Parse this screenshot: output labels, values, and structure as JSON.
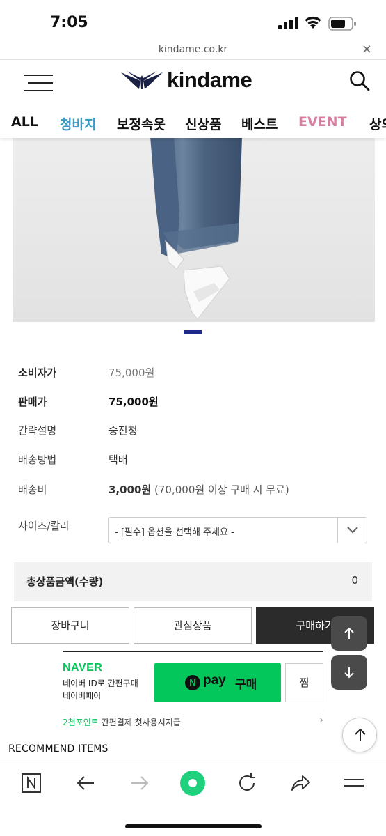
{
  "status": {
    "time": "7:05"
  },
  "urlbar": {
    "url": "kindame.co.kr",
    "close": "×"
  },
  "header": {
    "logo_text": "kindame"
  },
  "nav": {
    "items": [
      {
        "label": "ALL",
        "color": "#111111"
      },
      {
        "label": "청바지",
        "color": "#3a9bc8"
      },
      {
        "label": "보정속옷",
        "color": "#111111"
      },
      {
        "label": "신상품",
        "color": "#111111"
      },
      {
        "label": "베스트",
        "color": "#111111"
      },
      {
        "label": "EVENT",
        "color": "#d77da0"
      },
      {
        "label": "상의",
        "color": "#111111"
      }
    ]
  },
  "product": {
    "consumer_price_label": "소비자가",
    "consumer_price": "75,000원",
    "sale_price_label": "판매가",
    "sale_price": "75,000원",
    "summary_label": "간략설명",
    "summary": "중진청",
    "shipping_method_label": "배송방법",
    "shipping_method": "택배",
    "shipping_fee_label": "배송비",
    "shipping_fee": "3,000원",
    "shipping_fee_note": "(70,000원 이상 구매 시 무료)",
    "option_label": "사이즈/칼라",
    "option_placeholder": "- [필수] 옵션을 선택해 주세요 -"
  },
  "total": {
    "label": "총상품금액(수량)",
    "value": "0"
  },
  "buttons": {
    "cart": "장바구니",
    "wishlist": "관심상품",
    "buy": "구매하기"
  },
  "naver": {
    "brand": "NAVER",
    "desc_line1": "네이버 ID로 간편구매",
    "desc_line2": "네이버페이",
    "n_badge": "N",
    "pay": "pay",
    "buy": "구매",
    "jjim": "찜",
    "point_green": "2천포인트",
    "point_rest": " 간편결제 첫사용시지급",
    "chevron": "›"
  },
  "recommend": {
    "title": "RECOMMEND ITEMS"
  },
  "colors": {
    "accent_blue": "#1e2a8a",
    "naver_green": "#03c75a"
  }
}
